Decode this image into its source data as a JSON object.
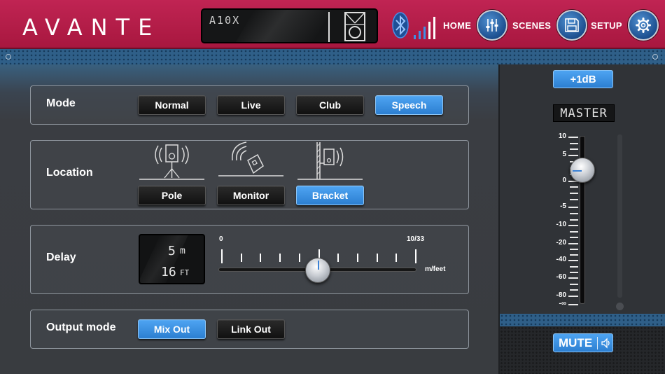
{
  "brand": {
    "logo": "AVANTE",
    "accent": "#b81d4a",
    "blue": "#3c8ee0"
  },
  "device": {
    "name": "A10X",
    "icon": "speaker-icon"
  },
  "status": {
    "bluetooth_icon": "bluetooth-icon",
    "signal_icon": "signal-strength-icon"
  },
  "nav": [
    {
      "label": "HOME",
      "icon": "sliders-icon"
    },
    {
      "label": "SCENES",
      "icon": "save-icon"
    },
    {
      "label": "SETUP",
      "icon": "gear-icon"
    }
  ],
  "mode": {
    "title": "Mode",
    "options": [
      "Normal",
      "Live",
      "Club",
      "Speech"
    ],
    "selected": "Speech"
  },
  "location": {
    "title": "Location",
    "options": [
      {
        "label": "Pole",
        "icon": "pole-mount-icon"
      },
      {
        "label": "Monitor",
        "icon": "floor-monitor-icon"
      },
      {
        "label": "Bracket",
        "icon": "wall-bracket-icon"
      }
    ],
    "selected": "Bracket"
  },
  "delay": {
    "title": "Delay",
    "meters_value": "5",
    "meters_unit": "m",
    "feet_value": "16",
    "feet_unit": "FT",
    "slider_min": "0",
    "slider_max": "10/33",
    "slider_unit": "m/feet",
    "slider_fraction": 0.5
  },
  "output_mode": {
    "title": "Output mode",
    "options": [
      "Mix Out",
      "Link Out"
    ],
    "selected": "Mix Out"
  },
  "master": {
    "gain_button": "+1dB",
    "label": "MASTER",
    "scale": [
      "10",
      "5",
      "0",
      "-5",
      "-10",
      "-20",
      "-40",
      "-60",
      "-80",
      "-∞"
    ],
    "level_db": 0,
    "mute_label": "MUTE",
    "mute_icon": "speaker-volume-icon"
  }
}
